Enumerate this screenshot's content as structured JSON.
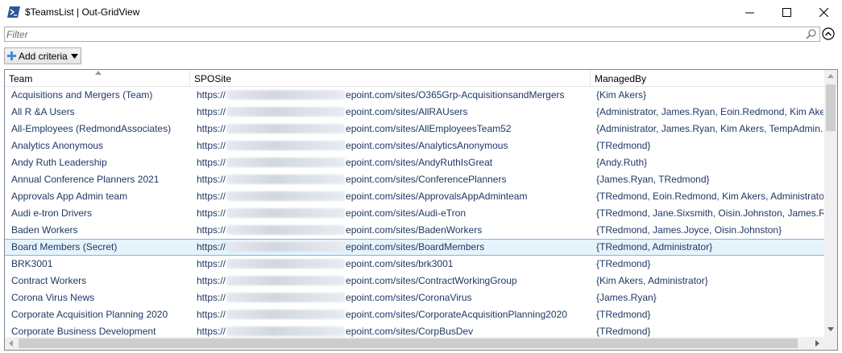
{
  "window": {
    "title": "$TeamsList | Out-GridView",
    "icon": "powershell-icon",
    "controls": [
      "minimize-icon",
      "maximize-icon",
      "close-icon"
    ]
  },
  "filter": {
    "placeholder": "Filter",
    "value": ""
  },
  "toolbar": {
    "add_criteria_label": "Add criteria"
  },
  "grid": {
    "columns": [
      "Team",
      "SPOSite",
      "ManagedBy"
    ],
    "sorted_column": "Team",
    "site_prefix": "https://",
    "rows": [
      {
        "team": "Acquisitions and Mergers (Team)",
        "site_suffix": "epoint.com/sites/O365Grp-AcquisitionsandMergers",
        "managed_by": "{Kim Akers}"
      },
      {
        "team": "All R &A Users",
        "site_suffix": "epoint.com/sites/AllRAUsers",
        "managed_by": "{Administrator, James.Ryan, Eoin.Redmond, Kim Akers"
      },
      {
        "team": "All-Employees (RedmondAssociates)",
        "site_suffix": "epoint.com/sites/AllEmployeesTeam52",
        "managed_by": "{Administrator, James.Ryan, Kim Akers, TempAdmin...}"
      },
      {
        "team": "Analytics Anonymous",
        "site_suffix": "epoint.com/sites/AnalyticsAnonymous",
        "managed_by": "{TRedmond}"
      },
      {
        "team": "Andy Ruth Leadership",
        "site_suffix": "epoint.com/sites/AndyRuthIsGreat",
        "managed_by": "{Andy.Ruth}"
      },
      {
        "team": "Annual Conference Planners 2021",
        "site_suffix": "epoint.com/sites/ConferencePlanners",
        "managed_by": "{James.Ryan, TRedmond}"
      },
      {
        "team": "Approvals App Admin team",
        "site_suffix": "epoint.com/sites/ApprovalsAppAdminteam",
        "managed_by": "{TRedmond, Eoin.Redmond, Kim Akers, Administrator."
      },
      {
        "team": "Audi e-tron Drivers",
        "site_suffix": "epoint.com/sites/Audi-eTron",
        "managed_by": "{TRedmond, Jane.Sixsmith, Oisin.Johnston, James.Ryan"
      },
      {
        "team": "Baden Workers",
        "site_suffix": "epoint.com/sites/BadenWorkers",
        "managed_by": "{TRedmond, James.Joyce, Oisin.Johnston}"
      },
      {
        "team": "Board Members (Secret)",
        "site_suffix": "epoint.com/sites/BoardMembers",
        "managed_by": "{TRedmond, Administrator}"
      },
      {
        "team": "BRK3001",
        "site_suffix": "epoint.com/sites/brk3001",
        "managed_by": "{TRedmond}"
      },
      {
        "team": "Contract Workers",
        "site_suffix": "epoint.com/sites/ContractWorkingGroup",
        "managed_by": "{Kim Akers, Administrator}"
      },
      {
        "team": "Corona Virus News",
        "site_suffix": "epoint.com/sites/CoronaVirus",
        "managed_by": "{James.Ryan}"
      },
      {
        "team": "Corporate Acquisition Planning 2020",
        "site_suffix": "epoint.com/sites/CorporateAcquisitionPlanning2020",
        "managed_by": "{TRedmond}"
      },
      {
        "team": "Corporate Business Development",
        "site_suffix": "epoint.com/sites/CorpBusDev",
        "managed_by": "{TRedmond}"
      }
    ],
    "selected_row_index": 9
  },
  "colors": {
    "text": "#1f3864",
    "selection_bg": "#e5f3fb",
    "selection_border": "#7eb4ea",
    "powershell_blue": "#2b5797"
  }
}
